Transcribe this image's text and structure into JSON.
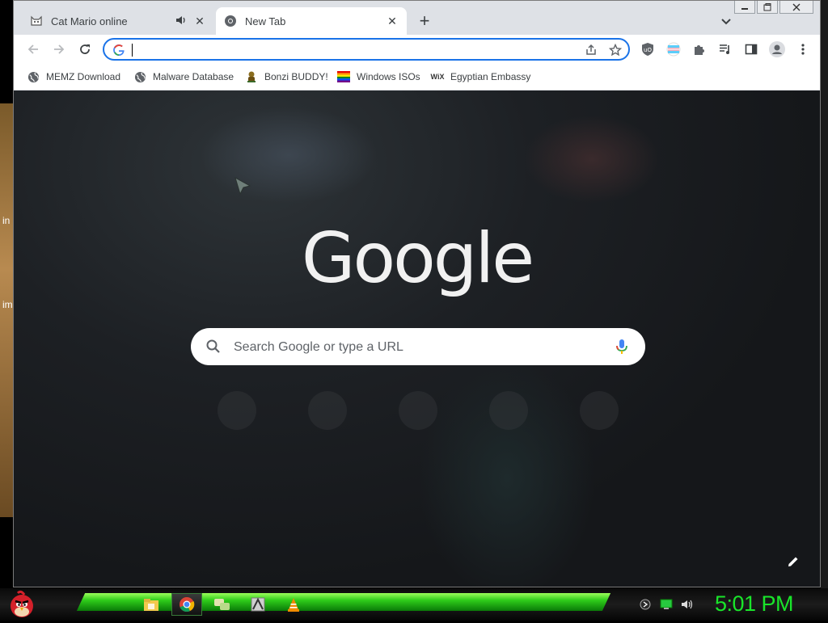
{
  "desktop": {
    "peek_texts": [
      "in",
      "im"
    ]
  },
  "tabs": [
    {
      "title": "Cat Mario online",
      "icon": "cat-icon",
      "audio": true,
      "active": false
    },
    {
      "title": "New Tab",
      "icon": "chrome-icon",
      "audio": false,
      "active": true
    }
  ],
  "omnibox": {
    "value": "",
    "placeholder": ""
  },
  "bookmarks": [
    {
      "label": "MEMZ Download",
      "icon": "globe-icon"
    },
    {
      "label": "Malware Database",
      "icon": "globe-icon"
    },
    {
      "label": "Bonzi BUDDY!",
      "icon": "bonzi-icon"
    },
    {
      "label": "Windows ISOs",
      "icon": "rainbow-flag-icon"
    },
    {
      "label": "Egyptian Embassy",
      "icon": "wix-icon"
    }
  ],
  "bookmark_wix_text": "WiX",
  "ntp": {
    "logo": "Google",
    "search_placeholder": "Search Google or type a URL"
  },
  "taskbar": {
    "clock": "5:01 PM"
  },
  "colors": {
    "accent": "#1a73e8",
    "clock": "#19e62a",
    "taskbar_green": "#2ecc1a"
  }
}
